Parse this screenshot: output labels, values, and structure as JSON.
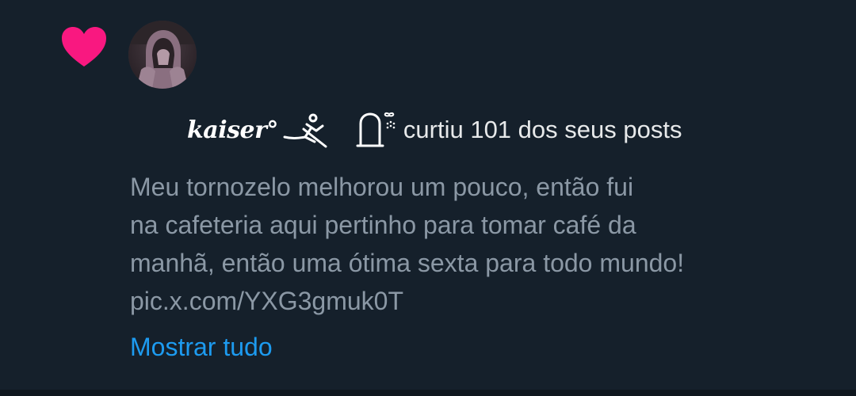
{
  "notification": {
    "type_icon": "heart-icon",
    "accent_color": "#f91880",
    "link_color": "#1d9bf0",
    "user": {
      "display_name": "kaiser°"
    },
    "action": "curtiu 101 dos seus posts",
    "post": {
      "lines": [
        "Meu tornozelo melhorou um pouco, então fui",
        "na cafeteria aqui pertinho para tomar café da",
        "manhã, então uma ótima sexta para todo mundo!",
        "pic.x.com/YXG3gmuk0T"
      ]
    },
    "show_more": "Mostrar tudo"
  }
}
